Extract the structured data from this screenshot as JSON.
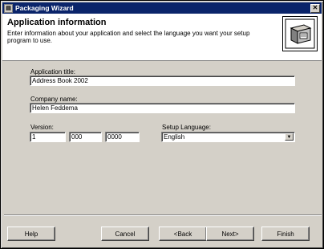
{
  "window": {
    "title": "Packaging Wizard",
    "close_label": "✕"
  },
  "header": {
    "title": "Application information",
    "description": "Enter information about your application and select the language you want your setup program to use."
  },
  "form": {
    "app_title_label": "Application title:",
    "app_title_value": "Address Book 2002",
    "company_label": "Company name:",
    "company_value": "Helen Feddema",
    "version_label": "Version:",
    "version_major": "1",
    "version_minor": "000",
    "version_revision": "0000",
    "language_label": "Setup Language:",
    "language_value": "English"
  },
  "buttons": {
    "help": "Help",
    "cancel": "Cancel",
    "back": "<Back",
    "next": "Next>",
    "finish": "Finish"
  }
}
